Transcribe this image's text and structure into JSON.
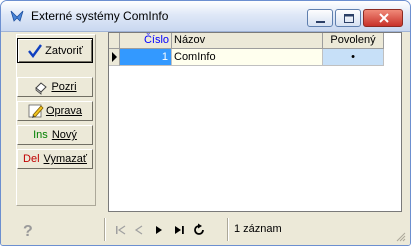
{
  "window": {
    "title": "Externé systémy ComInfo"
  },
  "buttons": {
    "zatvorit": {
      "label": "Zatvoriť",
      "icon": "checkmark-icon"
    },
    "pozri": {
      "label": "Pozri",
      "icon": "eraser-view-icon"
    },
    "oprava": {
      "label": "Oprava",
      "icon": "pencil-icon"
    },
    "novy": {
      "key": "Ins",
      "label": "Nový"
    },
    "vymazat": {
      "key": "Del",
      "label": "Vymazať"
    }
  },
  "grid": {
    "columns": [
      "Číslo",
      "Názov",
      "Povolený"
    ],
    "rows": [
      {
        "cislo": "1",
        "nazov": "ComInfo",
        "povoleny": "•"
      }
    ]
  },
  "statusbar": {
    "help": "?",
    "record_count": "1 záznam"
  },
  "colors": {
    "selected_cell": "#3399ff",
    "row_background": "#ffffee",
    "checkbox_cell": "#c7e0f8",
    "ins_key": "#008000",
    "del_key": "#c00000"
  }
}
